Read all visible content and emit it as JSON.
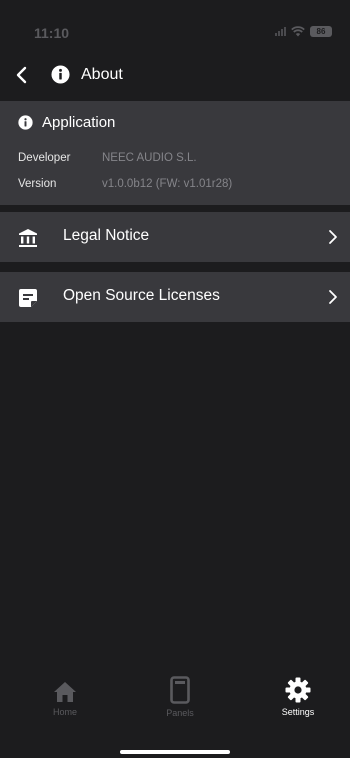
{
  "status_bar": {
    "time": "11:10",
    "battery": "86"
  },
  "nav": {
    "title": "About"
  },
  "application": {
    "title": "Application",
    "developer_label": "Developer",
    "developer_value": "NEEC AUDIO S.L.",
    "version_label": "Version",
    "version_value": "v1.0.0b12 (FW: v1.01r28)"
  },
  "menu": {
    "legal_notice": "Legal Notice",
    "open_source": "Open Source Licenses"
  },
  "tabs": {
    "home": "Home",
    "panels": "Panels",
    "settings": "Settings"
  },
  "colors": {
    "background": "#1c1c1e",
    "card": "#39393d",
    "tab_inactive": "#5a5a5e",
    "tab_active": "#ffffff"
  }
}
